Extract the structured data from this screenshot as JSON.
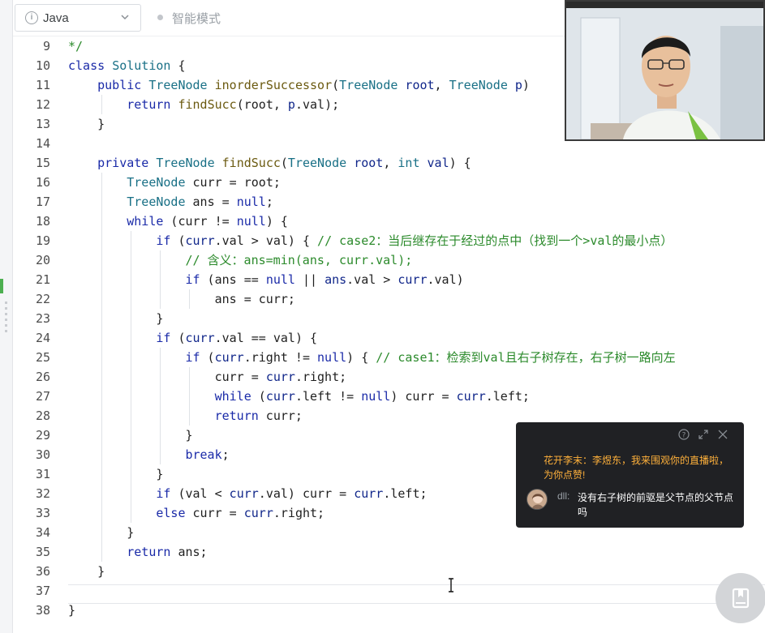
{
  "toolbar": {
    "language": "Java",
    "mode_label": "智能模式"
  },
  "editor": {
    "lines": [
      {
        "n": "9",
        "indent": 0,
        "tokens": [
          {
            "t": "*/",
            "c": "cm"
          }
        ]
      },
      {
        "n": "10",
        "indent": 0,
        "tokens": [
          {
            "t": "class",
            "c": "kw"
          },
          {
            "t": " "
          },
          {
            "t": "Solution",
            "c": "ty"
          },
          {
            "t": " {"
          }
        ]
      },
      {
        "n": "11",
        "indent": 1,
        "tokens": [
          {
            "t": "public",
            "c": "kw"
          },
          {
            "t": " "
          },
          {
            "t": "TreeNode",
            "c": "ty"
          },
          {
            "t": " "
          },
          {
            "t": "inorderSuccessor",
            "c": "fn"
          },
          {
            "t": "("
          },
          {
            "t": "TreeNode",
            "c": "ty"
          },
          {
            "t": " "
          },
          {
            "t": "root",
            "c": "pa"
          },
          {
            "t": ", "
          },
          {
            "t": "TreeNode",
            "c": "ty"
          },
          {
            "t": " "
          },
          {
            "t": "p",
            "c": "pa"
          },
          {
            "t": ")"
          }
        ]
      },
      {
        "n": "12",
        "indent": 2,
        "tokens": [
          {
            "t": "return",
            "c": "kw"
          },
          {
            "t": " "
          },
          {
            "t": "findSucc",
            "c": "fn"
          },
          {
            "t": "(root, "
          },
          {
            "t": "p",
            "c": "pa"
          },
          {
            "t": ".val);"
          }
        ]
      },
      {
        "n": "13",
        "indent": 1,
        "tokens": [
          {
            "t": "}"
          }
        ]
      },
      {
        "n": "14",
        "indent": 0,
        "tokens": []
      },
      {
        "n": "15",
        "indent": 1,
        "tokens": [
          {
            "t": "private",
            "c": "kw"
          },
          {
            "t": " "
          },
          {
            "t": "TreeNode",
            "c": "ty"
          },
          {
            "t": " "
          },
          {
            "t": "findSucc",
            "c": "fn"
          },
          {
            "t": "("
          },
          {
            "t": "TreeNode",
            "c": "ty"
          },
          {
            "t": " "
          },
          {
            "t": "root",
            "c": "pa"
          },
          {
            "t": ", "
          },
          {
            "t": "int",
            "c": "ty"
          },
          {
            "t": " "
          },
          {
            "t": "val",
            "c": "pa"
          },
          {
            "t": ") {"
          }
        ]
      },
      {
        "n": "16",
        "indent": 2,
        "tokens": [
          {
            "t": "TreeNode",
            "c": "ty"
          },
          {
            "t": " curr = root;"
          }
        ]
      },
      {
        "n": "17",
        "indent": 2,
        "tokens": [
          {
            "t": "TreeNode",
            "c": "ty"
          },
          {
            "t": " ans = "
          },
          {
            "t": "null",
            "c": "kw"
          },
          {
            "t": ";"
          }
        ]
      },
      {
        "n": "18",
        "indent": 2,
        "tokens": [
          {
            "t": "while",
            "c": "kw"
          },
          {
            "t": " (curr != "
          },
          {
            "t": "null",
            "c": "kw"
          },
          {
            "t": ") {"
          }
        ]
      },
      {
        "n": "19",
        "indent": 3,
        "tokens": [
          {
            "t": "if",
            "c": "kw"
          },
          {
            "t": " ("
          },
          {
            "t": "curr",
            "c": "pa"
          },
          {
            "t": ".val > val) { "
          },
          {
            "t": "// case2：当后继存在于经过的点中（找到一个>val的最小点）",
            "c": "cm"
          }
        ]
      },
      {
        "n": "20",
        "indent": 4,
        "tokens": [
          {
            "t": "// 含义：ans=min(ans, curr.val);",
            "c": "cm"
          }
        ]
      },
      {
        "n": "21",
        "indent": 4,
        "tokens": [
          {
            "t": "if",
            "c": "kw"
          },
          {
            "t": " (ans == "
          },
          {
            "t": "null",
            "c": "kw"
          },
          {
            "t": " || "
          },
          {
            "t": "ans",
            "c": "pa"
          },
          {
            "t": ".val > "
          },
          {
            "t": "curr",
            "c": "pa"
          },
          {
            "t": ".val)"
          }
        ]
      },
      {
        "n": "22",
        "indent": 5,
        "tokens": [
          {
            "t": "ans = curr;"
          }
        ]
      },
      {
        "n": "23",
        "indent": 3,
        "tokens": [
          {
            "t": "}"
          }
        ]
      },
      {
        "n": "24",
        "indent": 3,
        "tokens": [
          {
            "t": "if",
            "c": "kw"
          },
          {
            "t": " ("
          },
          {
            "t": "curr",
            "c": "pa"
          },
          {
            "t": ".val == val) {"
          }
        ]
      },
      {
        "n": "25",
        "indent": 4,
        "tokens": [
          {
            "t": "if",
            "c": "kw"
          },
          {
            "t": " ("
          },
          {
            "t": "curr",
            "c": "pa"
          },
          {
            "t": ".right != "
          },
          {
            "t": "null",
            "c": "kw"
          },
          {
            "t": ") { "
          },
          {
            "t": "// case1：检索到val且右子树存在，右子树一路向左",
            "c": "cm"
          }
        ]
      },
      {
        "n": "26",
        "indent": 5,
        "tokens": [
          {
            "t": "curr = "
          },
          {
            "t": "curr",
            "c": "pa"
          },
          {
            "t": ".right;"
          }
        ]
      },
      {
        "n": "27",
        "indent": 5,
        "tokens": [
          {
            "t": "while",
            "c": "kw"
          },
          {
            "t": " ("
          },
          {
            "t": "curr",
            "c": "pa"
          },
          {
            "t": ".left != "
          },
          {
            "t": "null",
            "c": "kw"
          },
          {
            "t": ") curr = "
          },
          {
            "t": "curr",
            "c": "pa"
          },
          {
            "t": ".left;"
          }
        ]
      },
      {
        "n": "28",
        "indent": 5,
        "tokens": [
          {
            "t": "return",
            "c": "kw"
          },
          {
            "t": " curr;"
          }
        ]
      },
      {
        "n": "29",
        "indent": 4,
        "tokens": [
          {
            "t": "}"
          }
        ]
      },
      {
        "n": "30",
        "indent": 4,
        "tokens": [
          {
            "t": "break",
            "c": "kw"
          },
          {
            "t": ";"
          }
        ]
      },
      {
        "n": "31",
        "indent": 3,
        "tokens": [
          {
            "t": "}"
          }
        ]
      },
      {
        "n": "32",
        "indent": 3,
        "tokens": [
          {
            "t": "if",
            "c": "kw"
          },
          {
            "t": " (val < "
          },
          {
            "t": "curr",
            "c": "pa"
          },
          {
            "t": ".val) curr = "
          },
          {
            "t": "curr",
            "c": "pa"
          },
          {
            "t": ".left;"
          }
        ]
      },
      {
        "n": "33",
        "indent": 3,
        "tokens": [
          {
            "t": "else",
            "c": "kw"
          },
          {
            "t": " curr = "
          },
          {
            "t": "curr",
            "c": "pa"
          },
          {
            "t": ".right;"
          }
        ]
      },
      {
        "n": "34",
        "indent": 2,
        "tokens": [
          {
            "t": "}"
          }
        ]
      },
      {
        "n": "35",
        "indent": 2,
        "tokens": [
          {
            "t": "return",
            "c": "kw"
          },
          {
            "t": " ans;"
          }
        ]
      },
      {
        "n": "36",
        "indent": 1,
        "tokens": [
          {
            "t": "}"
          }
        ]
      },
      {
        "n": "37",
        "indent": 0,
        "tokens": []
      },
      {
        "n": "38",
        "indent": 0,
        "tokens": [
          {
            "t": "}"
          }
        ]
      }
    ]
  },
  "chat": {
    "system_message": "花开李末：李煜东，我来围观你的直播啦，为你点赞!",
    "username": "dll:",
    "message": "没有右子树的前驱是父节点的父节点吗"
  },
  "colors": {
    "keyword": "#1a2aa8",
    "type": "#197086",
    "function": "#6b5a10",
    "comment": "#2b8a2b",
    "chat_highlight": "#ffb13b",
    "chat_background": "#202124"
  },
  "icons": {
    "language_select": "info-icon",
    "dropdown": "chevron-down-icon",
    "chat_controls": [
      "help-icon",
      "expand-icon",
      "close-icon"
    ],
    "float_button": "book-icon",
    "cursor": "text-cursor-icon"
  }
}
